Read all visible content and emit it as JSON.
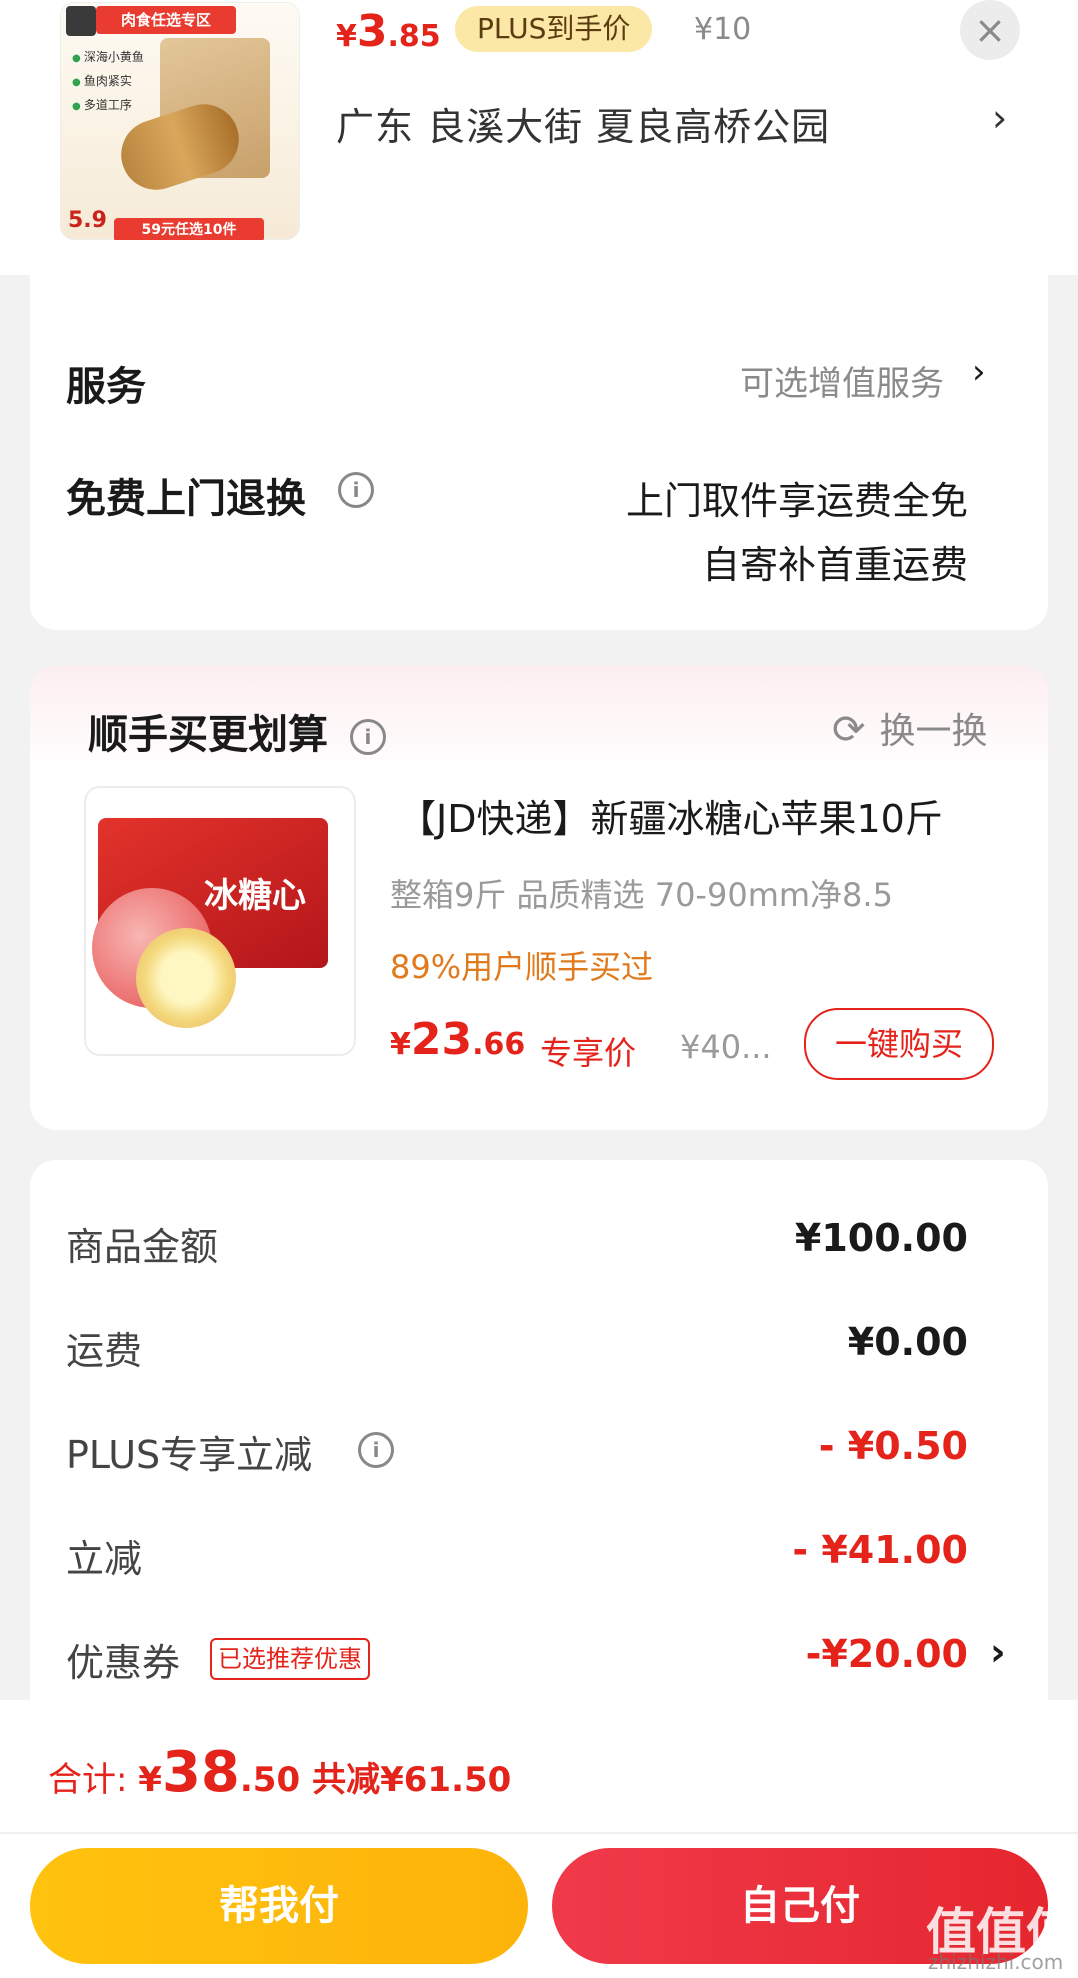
{
  "header": {
    "thumb": {
      "tag": "肉食任选专区",
      "bullets": [
        "深海小黄鱼",
        "鱼肉紧实",
        "多道工序"
      ],
      "price": "5.9",
      "promo": "59元任选10件"
    },
    "price_currency": "¥",
    "price_int": "3",
    "price_dec": ".85",
    "plus_badge": "PLUS到手价",
    "orig_price": "¥10",
    "close": "×",
    "address": "广东  良溪大街 夏良高桥公园",
    "address_arrow": "›"
  },
  "services": {
    "service_label": "服务",
    "service_value": "可选增值服务",
    "service_arrow": "›",
    "return_label": "免费上门退换",
    "return_line1": "上门取件享运费全免",
    "return_line2": "自寄补首重运费",
    "info": "i"
  },
  "recommend": {
    "title": "顺手买更划算",
    "info": "i",
    "refresh_icon": "⟳",
    "refresh_label": "换一换",
    "product": {
      "box_text": "冰糖心",
      "title": "【JD快递】新疆冰糖心苹果10斤",
      "desc": "整箱9斤 品质精选 70-90mm净8.5",
      "buyers": "89%用户顺手买过",
      "price_currency": "¥",
      "price_int": "23",
      "price_dec": ".66",
      "exclusive": "专享价",
      "orig_price": "¥40...",
      "buy_button": "一键购买"
    }
  },
  "summary": {
    "rows": [
      {
        "label": "商品金额",
        "value": "¥100.00"
      },
      {
        "label": "运费",
        "value": "¥0.00"
      },
      {
        "label": "PLUS专享立减",
        "value": "- ¥0.50"
      },
      {
        "label": "立减",
        "value": "- ¥41.00"
      },
      {
        "label": "优惠券",
        "value": "-¥20.00"
      }
    ],
    "coupon_tag": "已选推荐优惠",
    "coupon_arrow": "›",
    "info": "i"
  },
  "bottom": {
    "total_label": "合计: ",
    "total_currency": "¥",
    "total_int": "38",
    "total_dec": ".50",
    "saved": "共减¥61.50",
    "help_pay": "帮我付",
    "self_pay": "自己付",
    "watermark": "值值值",
    "watermark_sub": "zhizhizhi.com"
  },
  "colors": {
    "accent_red": "#e4231b",
    "help_yellow": "#ffc20e",
    "self_red": "#e5262f",
    "buyers_orange": "#e07a1c"
  }
}
